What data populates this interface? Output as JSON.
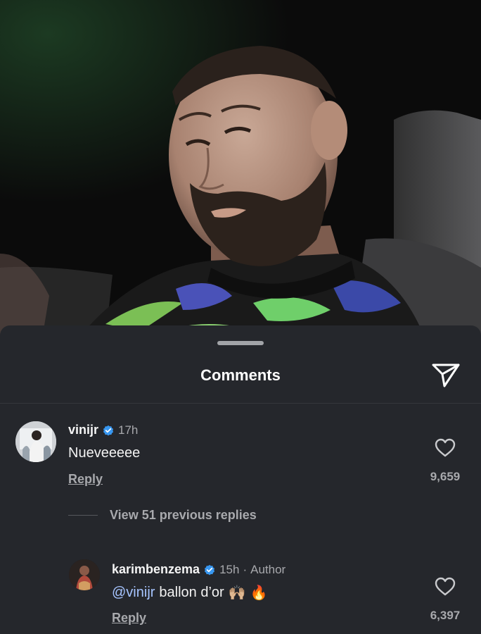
{
  "sheet": {
    "title": "Comments"
  },
  "colors": {
    "sheet_bg": "#25272c",
    "verified_blue": "#3897f0",
    "mention": "#a6c4ff",
    "muted": "#a8a9ad"
  },
  "icons": {
    "share": "paper-plane-icon",
    "verified": "verified-badge-icon",
    "like": "heart-outline-icon"
  },
  "comments": [
    {
      "username": "vinijr",
      "verified": true,
      "time": "17h",
      "text": "Nueveeeee",
      "reply_label": "Reply",
      "likes": "9,659"
    }
  ],
  "view_replies_label": "View 51 previous replies",
  "replies": [
    {
      "username": "karimbenzema",
      "verified": true,
      "time": "15h",
      "separator": "·",
      "author_label": "Author",
      "mention": "@vinijr",
      "text": "ballon d’or",
      "emojis": [
        "🙌🏼",
        "🔥"
      ],
      "reply_label": "Reply",
      "likes": "6,397"
    }
  ]
}
